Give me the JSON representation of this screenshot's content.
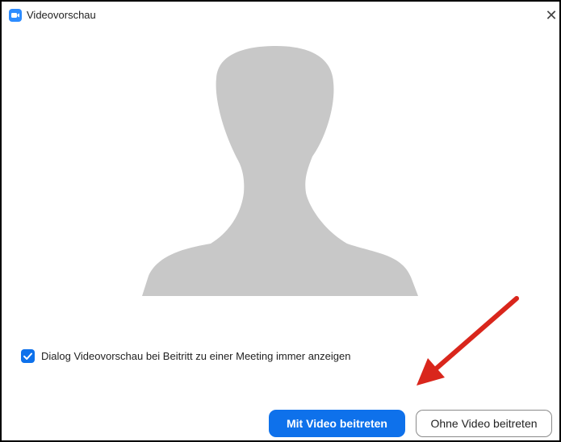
{
  "window": {
    "title": "Videovorschau",
    "close_glyph": "✕",
    "app_icon": "zoom-camera-icon"
  },
  "preview": {
    "placeholder": "avatar-silhouette",
    "silhouette_color": "#c8c8c8"
  },
  "options": {
    "show_preview_checked": true,
    "show_preview_label": "Dialog Videovorschau bei Beitritt zu einer Meeting immer anzeigen"
  },
  "buttons": {
    "join_with_video": "Mit Video beitreten",
    "join_without_video": "Ohne Video beitreten"
  },
  "annotation": {
    "arrow_color": "#d9261c"
  },
  "colors": {
    "accent": "#0e71eb",
    "border": "#000000"
  }
}
